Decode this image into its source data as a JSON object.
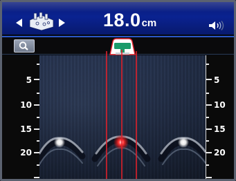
{
  "topbar": {
    "depth_value": "18.0",
    "depth_unit": "cm",
    "nav_left_icon": "arrow-left-icon",
    "nav_right_icon": "arrow-right-icon",
    "mode_icon": "wall-structure-icon",
    "volume_icon": "speaker-icon"
  },
  "subbar": {
    "search_icon": "magnifier-icon",
    "device_icon": "scanner-device-icon"
  },
  "scale": {
    "left_labels": [
      "5",
      "10",
      "15",
      "20"
    ],
    "right_labels": [
      "5",
      "10",
      "15",
      "20"
    ]
  },
  "colors": {
    "header_blue": "#0a2290",
    "guide_red": "#e0202a",
    "target_red": "#ff3030",
    "target_white": "#ffffff",
    "device_green": "#1a9b6a"
  },
  "detections": [
    {
      "name": "object-left",
      "depth_cm": 18.5,
      "highlighted": false
    },
    {
      "name": "object-center",
      "depth_cm": 18.0,
      "highlighted": true
    },
    {
      "name": "object-right",
      "depth_cm": 18.5,
      "highlighted": false
    }
  ]
}
